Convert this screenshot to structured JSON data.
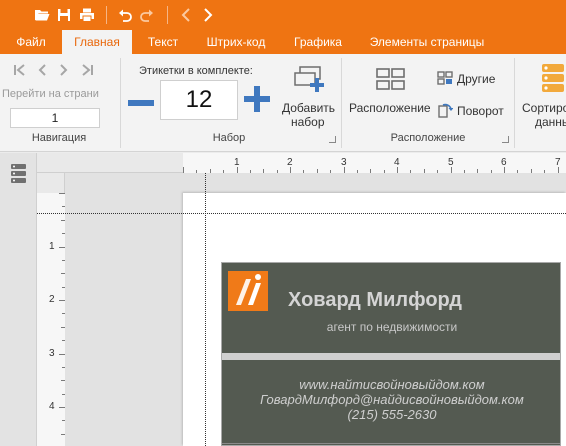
{
  "ribbon_tabs": [
    "Файл",
    "Главная",
    "Текст",
    "Штрих-код",
    "Графика",
    "Элементы страницы"
  ],
  "navigation": {
    "goto_label": "Перейти на страни",
    "page_value": "1",
    "group_label": "Навигация"
  },
  "set": {
    "count_label": "Этикетки в комплекте:",
    "count_value": "12",
    "add_label_line1": "Добавить",
    "add_label_line2": "набор",
    "group_label": "Набор"
  },
  "arrange": {
    "layout_label": "Расположение",
    "other_label": "Другие",
    "rotate_label": "Поворот",
    "group_label": "Расположение"
  },
  "sort": {
    "label_line1": "Сортиро",
    "label_line2": "данны"
  },
  "ruler": {
    "h_numbers": [
      "1",
      "2",
      "3",
      "4",
      "5",
      "6",
      "7"
    ],
    "v_numbers": [
      "1",
      "2",
      "3",
      "4"
    ]
  },
  "card": {
    "name": "Ховард Милфорд",
    "role": "агент по недвижимости",
    "website": "www.найтисвойновыйдом.ком",
    "email": "ГовардМилфорд@найдисвойновыйдом.ком",
    "phone": "(215) 555-2630"
  },
  "colors": {
    "accent": "#ef7412",
    "card_background": "#545a51",
    "logo_orange": "#f07a18"
  },
  "icons": [
    "open-folder-icon",
    "save-icon",
    "print-icon",
    "undo-icon",
    "redo-icon",
    "prev-icon",
    "next-icon",
    "first-page-icon",
    "prev-page-icon",
    "next-page-icon",
    "last-page-icon",
    "minus-icon",
    "plus-icon",
    "add-set-icon",
    "layout-grid-icon",
    "other-icon",
    "rotate-icon",
    "sort-data-icon",
    "label-sheets-icon"
  ]
}
